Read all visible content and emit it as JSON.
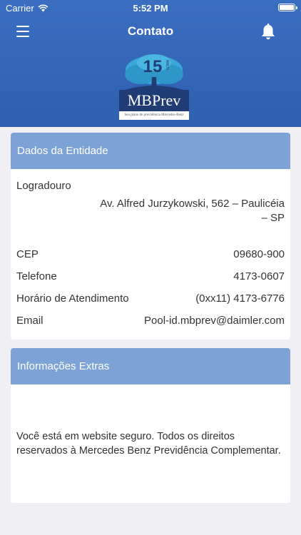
{
  "status_bar": {
    "carrier": "Carrier",
    "time": "5:52 PM"
  },
  "navbar": {
    "title": "Contato",
    "menu_icon": "hamburger-menu-icon",
    "notification_icon": "bell-icon"
  },
  "logo": {
    "anniversary": "15",
    "anniversary_suffix": "ANOS",
    "brand": "MBPrev",
    "tagline": "Seu plano de previdência Mercedes-Benz"
  },
  "entity_card": {
    "header": "Dados da Entidade",
    "address_label": "Logradouro",
    "address_value": "Av. Alfred Jurzykowski, 562 –  Paulicéia – SP",
    "fields": [
      {
        "label": "CEP",
        "value": "09680-900"
      },
      {
        "label": "Telefone",
        "value": "4173-0607"
      },
      {
        "label": "Horário de Atendimento",
        "value": "(0xx11) 4173-6776"
      },
      {
        "label": "Email",
        "value": "Pool-id.mbprev@daimler.com"
      }
    ]
  },
  "extras_card": {
    "header": "Informações Extras",
    "text": "Você está em website seguro. Todos os direitos reservados à Mercedes Benz Previdência Complementar."
  },
  "colors": {
    "header_bg": "#3366bb",
    "card_header_bg": "#7da3d6",
    "page_bg": "#efeff4",
    "logo_brand_bg": "#1f3d74",
    "logo_tree": "#3aa8d8"
  }
}
